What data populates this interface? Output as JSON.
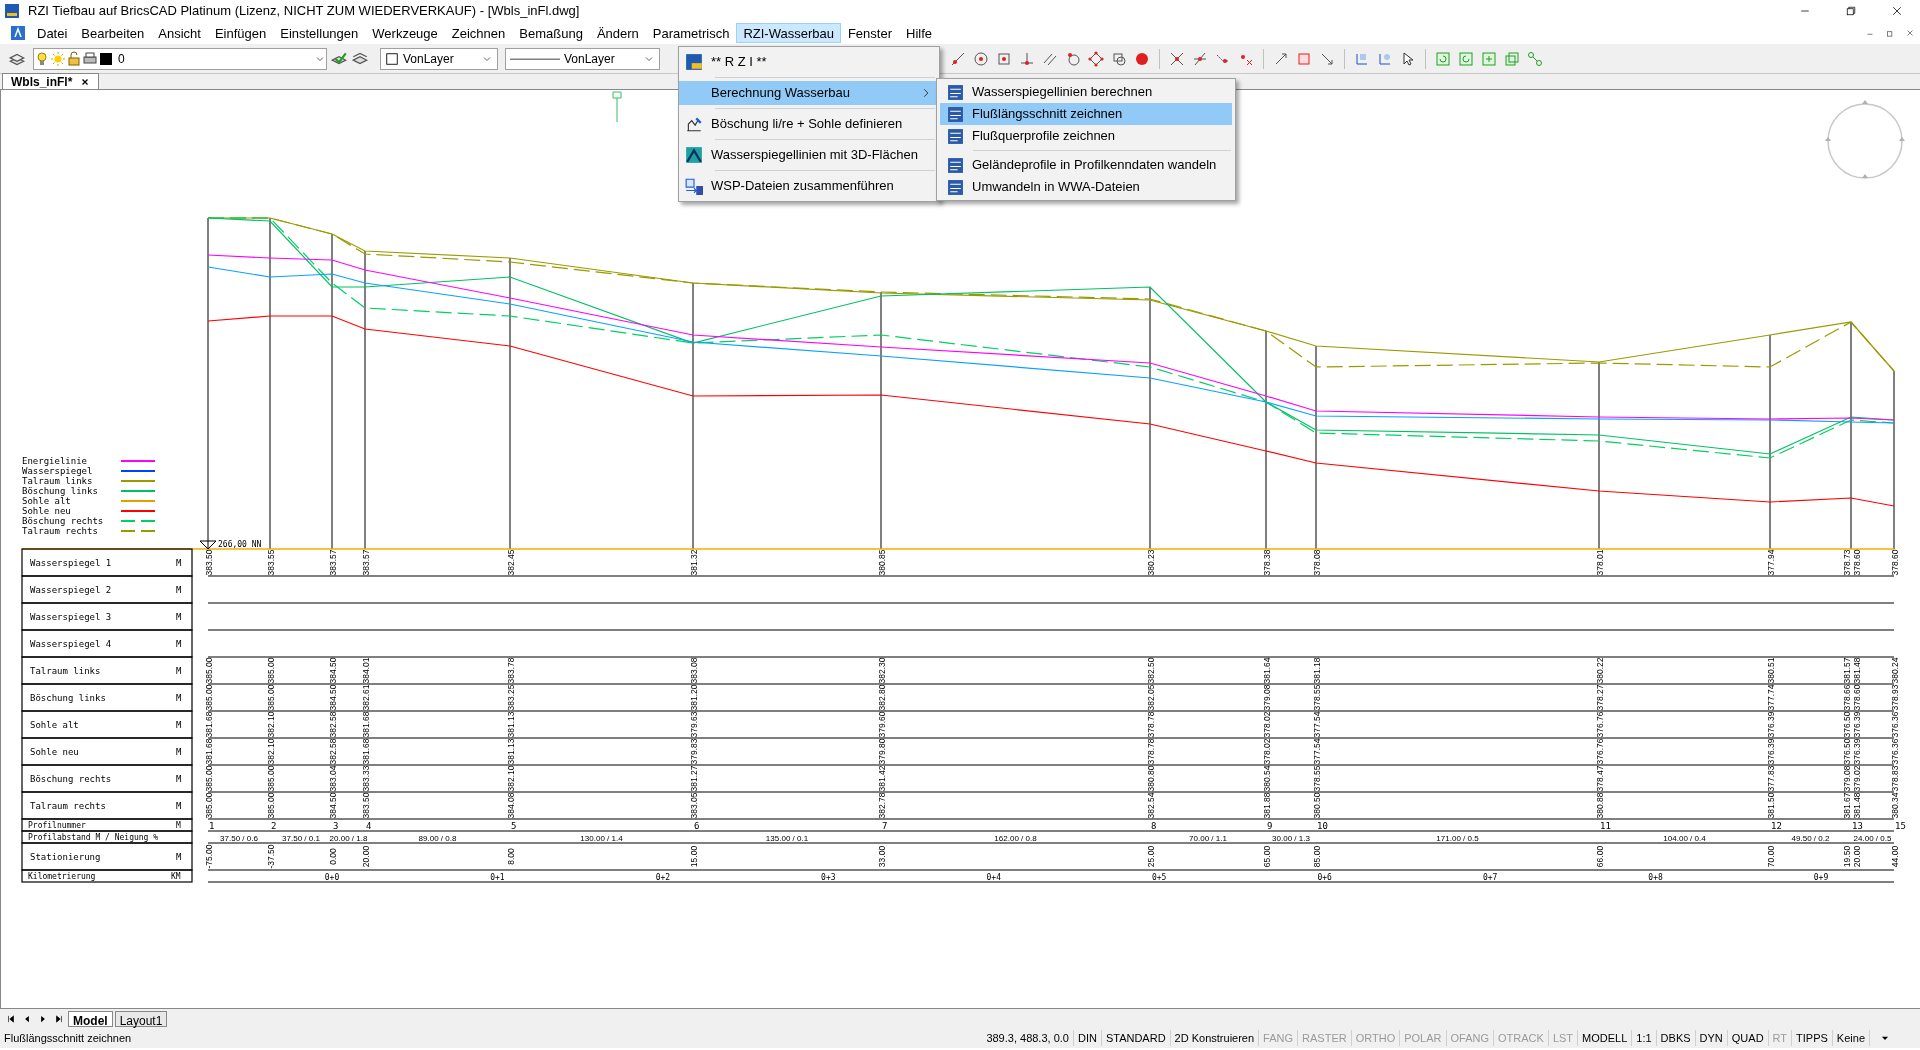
{
  "window": {
    "title": "RZI Tiefbau auf BricsCAD Platinum (Lizenz, NICHT ZUM WIEDERVERKAUF) - [Wbls_inFl.dwg]"
  },
  "menu_bar": [
    {
      "label": "Datei",
      "selected": false
    },
    {
      "label": "Bearbeiten",
      "selected": false
    },
    {
      "label": "Ansicht",
      "selected": false
    },
    {
      "label": "Einfügen",
      "selected": false
    },
    {
      "label": "Einstellungen",
      "selected": false
    },
    {
      "label": "Werkzeuge",
      "selected": false
    },
    {
      "label": "Zeichnen",
      "selected": false
    },
    {
      "label": "Bemaßung",
      "selected": false
    },
    {
      "label": "Ändern",
      "selected": false
    },
    {
      "label": "Parametrisch",
      "selected": false
    },
    {
      "label": "RZI-Wasserbau",
      "selected": true
    },
    {
      "label": "Fenster",
      "selected": false
    },
    {
      "label": "Hilfe",
      "selected": false
    }
  ],
  "toolbar": {
    "layer": "0",
    "pen_setting": "VonLayer",
    "linetype": "VonLayer"
  },
  "dropdown": [
    {
      "label": "** R Z I **",
      "selected": false,
      "submenu": false
    },
    {
      "label": "Berechnung Wasserbau",
      "selected": true,
      "submenu": true
    },
    {
      "label": "Böschung li/re + Sohle definieren",
      "selected": false,
      "submenu": false
    },
    {
      "label": "Wasserspiegellinien mit 3D-Flächen",
      "selected": false,
      "submenu": false
    },
    {
      "label": "WSP-Dateien zusammenführen",
      "selected": false,
      "submenu": false
    }
  ],
  "submenu": [
    {
      "label": "Wasserspiegellinien berechnen",
      "selected": false
    },
    {
      "label": "Flußlängsschnitt zeichnen",
      "selected": true
    },
    {
      "label": "Flußquerprofile zeichnen",
      "selected": false
    },
    {
      "label": "Geländeprofile in Profilkenndaten wandeln",
      "selected": false
    },
    {
      "label": "Umwandeln in WWA-Dateien",
      "selected": false
    }
  ],
  "document_tab": {
    "label": "Wbls_inFl*"
  },
  "drawing": {
    "legend": [
      {
        "label": "Energielinie",
        "color": "#ff00ff",
        "dashed": false
      },
      {
        "label": "Wasserspiegel",
        "color": "#0040ff",
        "dashed": false
      },
      {
        "label": "Talraum links",
        "color": "#9a9a00",
        "dashed": false
      },
      {
        "label": "Böschung links",
        "color": "#00c060",
        "dashed": false
      },
      {
        "label": "Sohle alt",
        "color": "#e0a000",
        "dashed": false
      },
      {
        "label": "Sohle neu",
        "color": "#ff0000",
        "dashed": false
      },
      {
        "label": "Böschung rechts",
        "color": "#00d060",
        "dashed": true
      },
      {
        "label": "Talraum rechts",
        "color": "#9a9a00",
        "dashed": true
      }
    ],
    "datum_label": "266,00 NN",
    "table": [
      {
        "kind": "values",
        "label": "Wasserspiegel 1",
        "unit": "M",
        "values": [
          [
            "383.50"
          ],
          [
            "383.55"
          ],
          [
            "383.57"
          ],
          [
            "383.57"
          ],
          [
            "382.45"
          ],
          [
            "381.32"
          ],
          [
            "380.85"
          ],
          [
            "380.23"
          ],
          [
            "378.38"
          ],
          [
            "378.08"
          ],
          [
            "378.01"
          ],
          [
            "377.94"
          ],
          [
            "378.73",
            "378.60"
          ],
          [
            "378.60"
          ]
        ]
      },
      {
        "kind": "values",
        "label": "Wasserspiegel 2",
        "unit": "M"
      },
      {
        "kind": "values",
        "label": "Wasserspiegel 3",
        "unit": "M"
      },
      {
        "kind": "values",
        "label": "Wasserspiegel 4",
        "unit": "M"
      },
      {
        "kind": "values",
        "label": "Talraum links",
        "unit": "M",
        "values": [
          [
            "385.00"
          ],
          [
            "385.00"
          ],
          [
            "384.50"
          ],
          [
            "384.01"
          ],
          [
            "383.78"
          ],
          [
            "383.08"
          ],
          [
            "382.30"
          ],
          [
            "382.50"
          ],
          [
            "381.64"
          ],
          [
            "381.18"
          ],
          [
            "380.22"
          ],
          [
            "380.51"
          ],
          [
            "381.57",
            "381.48"
          ],
          [
            "380.24"
          ]
        ]
      },
      {
        "kind": "values",
        "label": "Böschung links",
        "unit": "M",
        "values": [
          [
            "385.00"
          ],
          [
            "385.00"
          ],
          [
            "384.50"
          ],
          [
            "382.61"
          ],
          [
            "383.25"
          ],
          [
            "381.20"
          ],
          [
            "382.80"
          ],
          [
            "382.05"
          ],
          [
            "379.08"
          ],
          [
            "378.55"
          ],
          [
            "378.27"
          ],
          [
            "377.74"
          ],
          [
            "378.66",
            "378.60"
          ],
          [
            "378.93"
          ]
        ]
      },
      {
        "kind": "values",
        "label": "Sohle alt",
        "unit": "M",
        "values": [
          [
            "381.68"
          ],
          [
            "382.10"
          ],
          [
            "382.58"
          ],
          [
            "381.68"
          ],
          [
            "381.13"
          ],
          [
            "379.63"
          ],
          [
            "379.60"
          ],
          [
            "378.78"
          ],
          [
            "378.02"
          ],
          [
            "377.54"
          ],
          [
            "376.76"
          ],
          [
            "376.39"
          ],
          [
            "376.50",
            "376.39"
          ],
          [
            "376.36"
          ]
        ]
      },
      {
        "kind": "values",
        "label": "Sohle neu",
        "unit": "M",
        "values": [
          [
            "381.68"
          ],
          [
            "382.10"
          ],
          [
            "382.58"
          ],
          [
            "381.68"
          ],
          [
            "381.13"
          ],
          [
            "379.83"
          ],
          [
            "379.80"
          ],
          [
            "378.78"
          ],
          [
            "378.02"
          ],
          [
            "377.54"
          ],
          [
            "376.76"
          ],
          [
            "376.39"
          ],
          [
            "376.50",
            "376.39"
          ],
          [
            "376.36"
          ]
        ]
      },
      {
        "kind": "values",
        "label": "Böschung rechts",
        "unit": "M",
        "values": [
          [
            "385.00"
          ],
          [
            "385.00"
          ],
          [
            "383.04"
          ],
          [
            "383.33"
          ],
          [
            "382.10"
          ],
          [
            "381.27"
          ],
          [
            "381.42"
          ],
          [
            "380.80"
          ],
          [
            "380.54"
          ],
          [
            "378.55"
          ],
          [
            "378.47"
          ],
          [
            "377.83"
          ],
          [
            "379.08",
            "379.02"
          ],
          [
            "378.83"
          ]
        ]
      },
      {
        "kind": "values",
        "label": "Talraum rechts",
        "unit": "M",
        "values": [
          [
            "385.00"
          ],
          [
            "385.00"
          ],
          [
            "384.50"
          ],
          [
            "383.50"
          ],
          [
            "384.08"
          ],
          [
            "383.05"
          ],
          [
            "382.78"
          ],
          [
            "382.54"
          ],
          [
            "381.88"
          ],
          [
            "380.50"
          ],
          [
            "380.88"
          ],
          [
            "381.50"
          ],
          [
            "381.67",
            "381.48"
          ],
          [
            "380.34"
          ]
        ]
      },
      {
        "kind": "numbers",
        "label": "Profilnummer",
        "unit": "M",
        "values": [
          "1",
          "2",
          "3",
          "4",
          "5",
          "6",
          "7",
          "8",
          "9",
          "10",
          "11",
          "12",
          "13",
          "15"
        ]
      },
      {
        "kind": "intervals",
        "label": "Profilabstand M / Neigung %",
        "values": [
          "37.50 / 0.6",
          "37.50 / 0.1",
          "20.00 / 1.8",
          "89.00 / 0.8",
          "130.00 / 1.4",
          "135.00 / 0.1",
          "162.00 / 0.8",
          "70.00 / 1.1",
          "30.00 / 1.3",
          "171.00 / 0.5",
          "104.00 / 0.4",
          "49.50 / 0.2",
          "24.00 / 0.5"
        ]
      },
      {
        "kind": "values",
        "label": "Stationierung",
        "unit": "M",
        "values": [
          [
            "-75.00"
          ],
          [
            "-37.50"
          ],
          [
            "0.00"
          ],
          [
            "20.00"
          ],
          [
            "8.00"
          ],
          [
            "15.00"
          ],
          [
            "33.00"
          ],
          [
            "25.00"
          ],
          [
            "65.00"
          ],
          [
            "85.00"
          ],
          [
            "66.00"
          ],
          [
            "70.00"
          ],
          [
            "19.50",
            "20.00"
          ],
          [
            "44.00"
          ]
        ]
      },
      {
        "kind": "km",
        "label": "Kilometrierung",
        "unit": "KM",
        "values": [
          "0+0",
          "0+1",
          "0+2",
          "0+3",
          "0+4",
          "0+5",
          "0+6",
          "0+7",
          "0+8",
          "0+9"
        ]
      }
    ]
  },
  "layout_tabs": [
    {
      "label": "Model",
      "selected": true
    },
    {
      "label": "Layout1",
      "selected": false
    }
  ],
  "status_bar": {
    "message": "Flußlängsschnitt zeichnen",
    "items": [
      {
        "label": "389.3, 488.3, 0.0",
        "on": true
      },
      {
        "label": "DIN",
        "on": true
      },
      {
        "label": "STANDARD",
        "on": true
      },
      {
        "label": "2D Konstruieren",
        "on": true
      },
      {
        "label": "FANG",
        "on": false
      },
      {
        "label": "RASTER",
        "on": false
      },
      {
        "label": "ORTHO",
        "on": false
      },
      {
        "label": "POLAR",
        "on": false
      },
      {
        "label": "OFANG",
        "on": false
      },
      {
        "label": "OTRACK",
        "on": false
      },
      {
        "label": "LST",
        "on": false
      },
      {
        "label": "MODELL",
        "on": true
      },
      {
        "label": "1:1",
        "on": true
      },
      {
        "label": "DBKS",
        "on": true
      },
      {
        "label": "DYN",
        "on": true
      },
      {
        "label": "QUAD",
        "on": true
      },
      {
        "label": "RT",
        "on": false
      },
      {
        "label": "TIPPS",
        "on": true
      },
      {
        "label": "Keine",
        "on": true
      }
    ]
  }
}
